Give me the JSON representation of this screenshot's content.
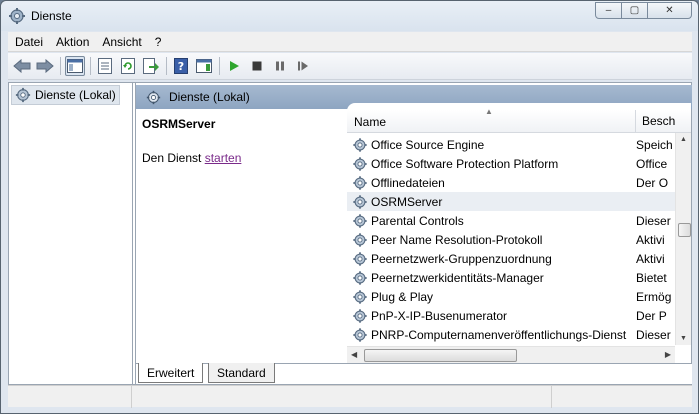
{
  "window": {
    "title": "Dienste",
    "minimize": "–",
    "maximize": "▢",
    "close": "✕"
  },
  "menu": [
    "Datei",
    "Aktion",
    "Ansicht",
    "?"
  ],
  "toolbar_icons": [
    "back-icon",
    "forward-icon",
    "show-hide-console-tree-icon",
    "properties-icon",
    "refresh-icon",
    "export-list-icon",
    "help-icon",
    "action-pane-icon",
    "start-service-icon",
    "stop-service-icon",
    "pause-service-icon",
    "resume-service-icon"
  ],
  "tree": {
    "root_label": "Dienste (Lokal)"
  },
  "right_pane": {
    "header_label": "Dienste (Lokal)",
    "selected_service": "OSRMServer",
    "action_prefix": "Den Dienst ",
    "action_link": "starten"
  },
  "list": {
    "columns": {
      "name": "Name",
      "description": "Besch"
    },
    "rows": [
      {
        "name": "Office  Source Engine",
        "desc": "Speich",
        "selected": false
      },
      {
        "name": "Office Software Protection Platform",
        "desc": "Office",
        "selected": false
      },
      {
        "name": "Offlinedateien",
        "desc": "Der O",
        "selected": false
      },
      {
        "name": "OSRMServer",
        "desc": "",
        "selected": true
      },
      {
        "name": "Parental Controls",
        "desc": "Dieser",
        "selected": false
      },
      {
        "name": "Peer Name Resolution-Protokoll",
        "desc": "Aktivi",
        "selected": false
      },
      {
        "name": "Peernetzwerk-Gruppenzuordnung",
        "desc": "Aktivi",
        "selected": false
      },
      {
        "name": "Peernetzwerkidentitäts-Manager",
        "desc": "Bietet",
        "selected": false
      },
      {
        "name": "Plug & Play",
        "desc": "Ermög",
        "selected": false
      },
      {
        "name": "PnP-X-IP-Busenumerator",
        "desc": "Der P",
        "selected": false
      },
      {
        "name": "PNRP-Computernamenveröffentlichungs-Dienst",
        "desc": "Dieser",
        "selected": false
      }
    ]
  },
  "tabs": [
    "Erweitert",
    "Standard"
  ]
}
